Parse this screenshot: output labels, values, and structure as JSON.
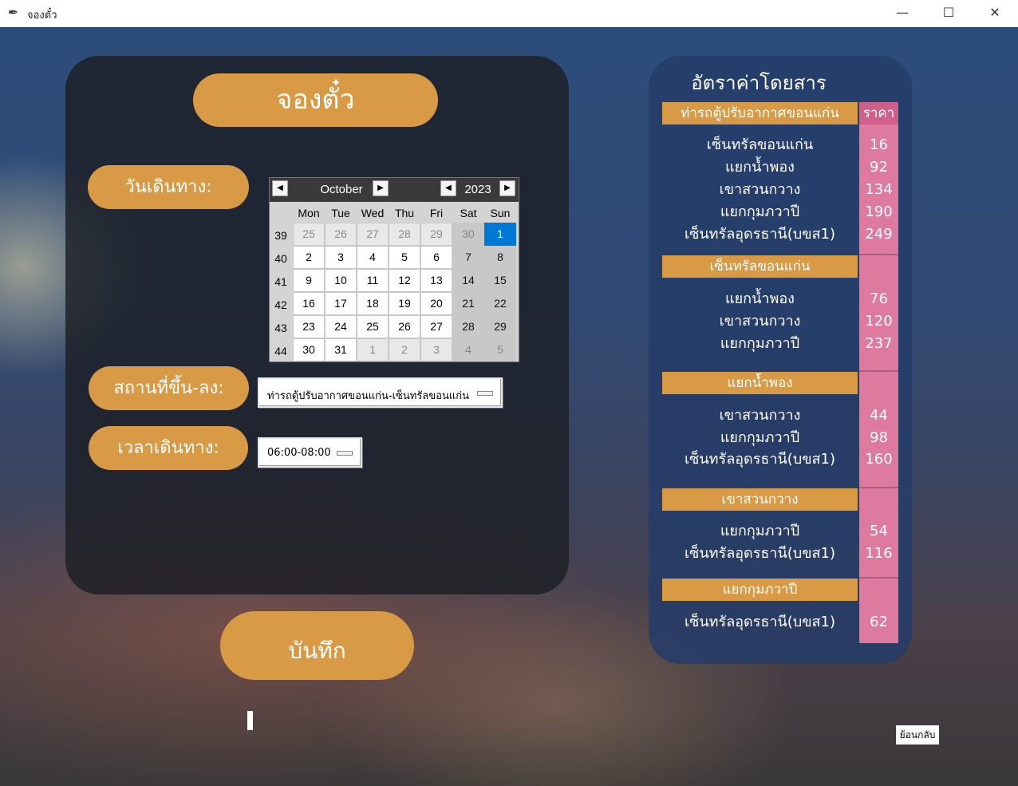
{
  "window": {
    "title": "จองตั๋ว",
    "minimize": "—",
    "maximize": "☐",
    "close": "✕"
  },
  "booking": {
    "title": "จองตั๋ว",
    "date_label": "วันเดินทาง:",
    "place_label": "สถานที่ขึ้น-ลง:",
    "time_label": "เวลาเดินทาง:",
    "save_label": "บันทึก",
    "place_value": "ท่ารถตู้ปรับอากาศขอนแก่น-เซ็นทรัลขอนแก่น",
    "time_value": "06:00-08:00"
  },
  "calendar": {
    "month": "October",
    "year": "2023",
    "day_headers": [
      "Mon",
      "Tue",
      "Wed",
      "Thu",
      "Fri",
      "Sat",
      "Sun"
    ],
    "weeks": [
      {
        "num": "39",
        "days": [
          "25",
          "26",
          "27",
          "28",
          "29",
          "30",
          "1"
        ],
        "other": [
          true,
          true,
          true,
          true,
          true,
          true,
          false
        ]
      },
      {
        "num": "40",
        "days": [
          "2",
          "3",
          "4",
          "5",
          "6",
          "7",
          "8"
        ],
        "other": [
          false,
          false,
          false,
          false,
          false,
          false,
          false
        ]
      },
      {
        "num": "41",
        "days": [
          "9",
          "10",
          "11",
          "12",
          "13",
          "14",
          "15"
        ],
        "other": [
          false,
          false,
          false,
          false,
          false,
          false,
          false
        ]
      },
      {
        "num": "42",
        "days": [
          "16",
          "17",
          "18",
          "19",
          "20",
          "21",
          "22"
        ],
        "other": [
          false,
          false,
          false,
          false,
          false,
          false,
          false
        ]
      },
      {
        "num": "43",
        "days": [
          "23",
          "24",
          "25",
          "26",
          "27",
          "28",
          "29"
        ],
        "other": [
          false,
          false,
          false,
          false,
          false,
          false,
          false
        ]
      },
      {
        "num": "44",
        "days": [
          "30",
          "31",
          "1",
          "2",
          "3",
          "4",
          "5"
        ],
        "other": [
          false,
          false,
          true,
          true,
          true,
          true,
          true
        ]
      }
    ],
    "selected": "1"
  },
  "fares": {
    "title": "อัตราค่าโดยสาร",
    "price_header": "ราคา",
    "sections": [
      {
        "origin": "ท่ารถตู้ปรับอากาศขอนแก่น",
        "stops": [
          {
            "name": "เซ็นทรัลขอนแก่น",
            "price": "16"
          },
          {
            "name": "แยกน้ำพอง",
            "price": "92"
          },
          {
            "name": "เขาสวนกวาง",
            "price": "134"
          },
          {
            "name": "แยกกุมภวาปี",
            "price": "190"
          },
          {
            "name": "เซ็นทรัลอุดรธานี(บขส1)",
            "price": "249"
          }
        ]
      },
      {
        "origin": "เซ็นทรัลขอนแก่น",
        "stops": [
          {
            "name": "แยกน้ำพอง",
            "price": "76"
          },
          {
            "name": "เขาสวนกวาง",
            "price": "120"
          },
          {
            "name": "แยกกุมภวาปี",
            "price": "237"
          }
        ]
      },
      {
        "origin": "แยกน้ำพอง",
        "stops": [
          {
            "name": "เขาสวนกวาง",
            "price": "44"
          },
          {
            "name": "แยกกุมภวาปี",
            "price": "98"
          },
          {
            "name": "เซ็นทรัลอุดรธานี(บขส1)",
            "price": "160"
          }
        ]
      },
      {
        "origin": "เขาสวนกวาง",
        "stops": [
          {
            "name": "แยกกุมภวาปี",
            "price": "54"
          },
          {
            "name": "เซ็นทรัลอุดรธานี(บขส1)",
            "price": "116"
          }
        ]
      },
      {
        "origin": "แยกกุมภวาปี",
        "stops": [
          {
            "name": "เซ็นทรัลอุดรธานี(บขส1)",
            "price": "62"
          }
        ]
      }
    ]
  },
  "back_label": "ย้อนกลับ"
}
